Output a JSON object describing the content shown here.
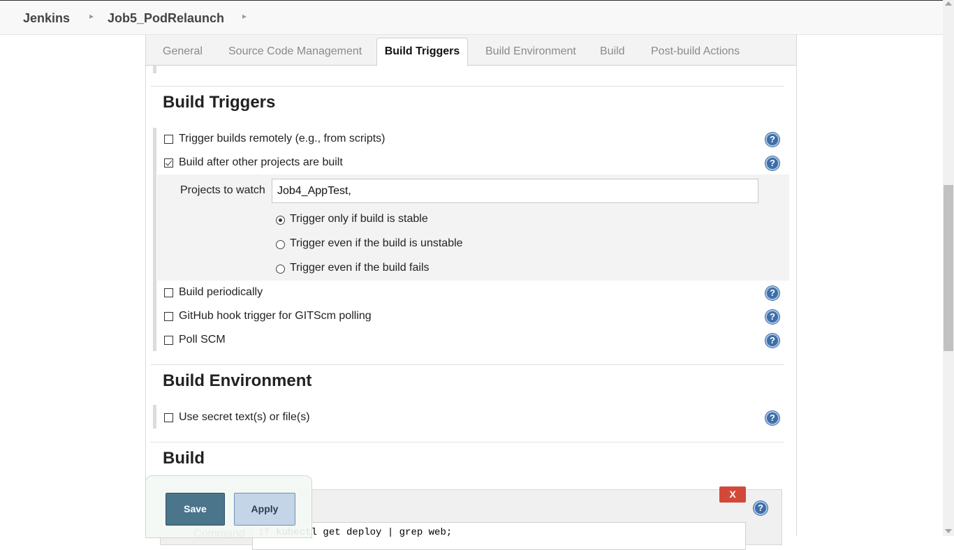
{
  "breadcrumb": {
    "root": "Jenkins",
    "job": "Job5_PodRelaunch"
  },
  "tabs": [
    "General",
    "Source Code Management",
    "Build Triggers",
    "Build Environment",
    "Build",
    "Post-build Actions"
  ],
  "active_tab": "Build Triggers",
  "build_triggers": {
    "title": "Build Triggers",
    "trigger_remotely": "Trigger builds remotely (e.g., from scripts)",
    "build_after_other": "Build after other projects are built",
    "projects_to_watch_label": "Projects to watch",
    "projects_to_watch_value": "Job4_AppTest,",
    "radio_stable": "Trigger only if build is stable",
    "radio_unstable": "Trigger even if the build is unstable",
    "radio_fails": "Trigger even if the build fails",
    "build_periodically": "Build periodically",
    "github_hook": "GitHub hook trigger for GITScm polling",
    "poll_scm": "Poll SCM",
    "checked": {
      "trigger_remotely": false,
      "build_after_other": true,
      "build_periodically": false,
      "github_hook": false,
      "poll_scm": false
    },
    "selected_radio": "stable"
  },
  "build_environment": {
    "title": "Build Environment",
    "secret_text": "Use secret text(s) or file(s)"
  },
  "build": {
    "title": "Build",
    "delete_label": "X",
    "command_label": "Command",
    "command_keyword_if": "if",
    "command_rest": " kubectl get deploy | grep web;"
  },
  "help_label": "?",
  "buttons": {
    "save": "Save",
    "apply": "Apply"
  },
  "colors": {
    "help": "#3d6ea8",
    "save": "#4b758b",
    "apply": "#c4d5e8",
    "delete": "#d24939"
  }
}
